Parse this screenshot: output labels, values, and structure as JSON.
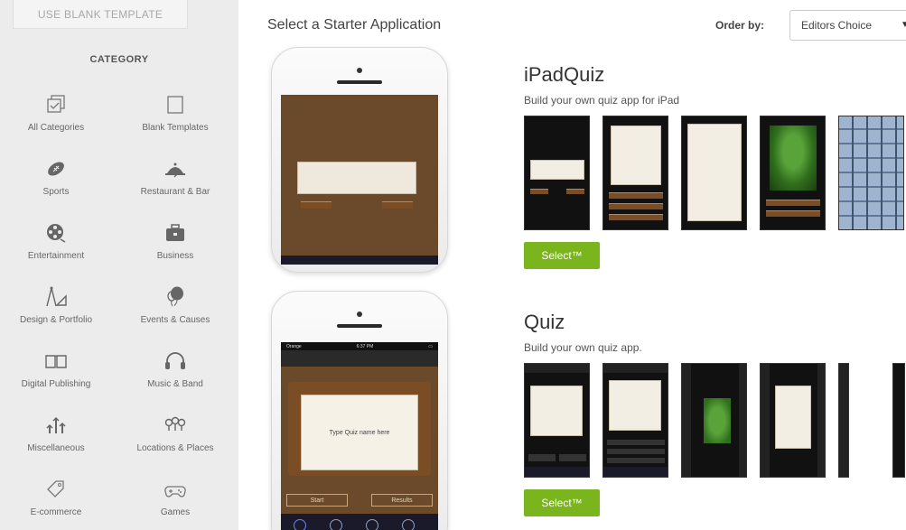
{
  "sidebar": {
    "blank_template_label": "USE BLANK TEMPLATE",
    "category_title": "CATEGORY",
    "categories": [
      {
        "label": "All Categories",
        "icon": "all-categories-icon"
      },
      {
        "label": "Blank Templates",
        "icon": "blank-template-icon"
      },
      {
        "label": "Sports",
        "icon": "football-icon"
      },
      {
        "label": "Restaurant & Bar",
        "icon": "cloche-icon"
      },
      {
        "label": "Entertainment",
        "icon": "film-reel-icon"
      },
      {
        "label": "Business",
        "icon": "briefcase-icon"
      },
      {
        "label": "Design & Portfolio",
        "icon": "compass-ruler-icon"
      },
      {
        "label": "Events & Causes",
        "icon": "balloons-icon"
      },
      {
        "label": "Digital Publishing",
        "icon": "book-icon"
      },
      {
        "label": "Music & Band",
        "icon": "headphones-icon"
      },
      {
        "label": "Miscellaneous",
        "icon": "misc-arrows-icon"
      },
      {
        "label": "Locations & Places",
        "icon": "map-pins-icon"
      },
      {
        "label": "E-commerce",
        "icon": "price-tag-icon"
      },
      {
        "label": "Games",
        "icon": "gamepad-icon"
      }
    ]
  },
  "header": {
    "heading": "Select a Starter Application",
    "order_label": "Order by:",
    "order_value": "Editors Choice"
  },
  "apps": [
    {
      "title": "iPadQuiz",
      "description": "Build your own quiz app for iPad",
      "select_label": "Select™"
    },
    {
      "title": "Quiz",
      "description": "Build your own quiz app.",
      "select_label": "Select™",
      "phone_quiz_text": "Type Quiz name here",
      "phone_start": "Start",
      "phone_results": "Results",
      "phone_status_carrier": "Orange",
      "phone_status_time": "6:37 PM"
    }
  ],
  "colors": {
    "select_button": "#7ab51d",
    "sidebar_bg": "#ececec"
  }
}
